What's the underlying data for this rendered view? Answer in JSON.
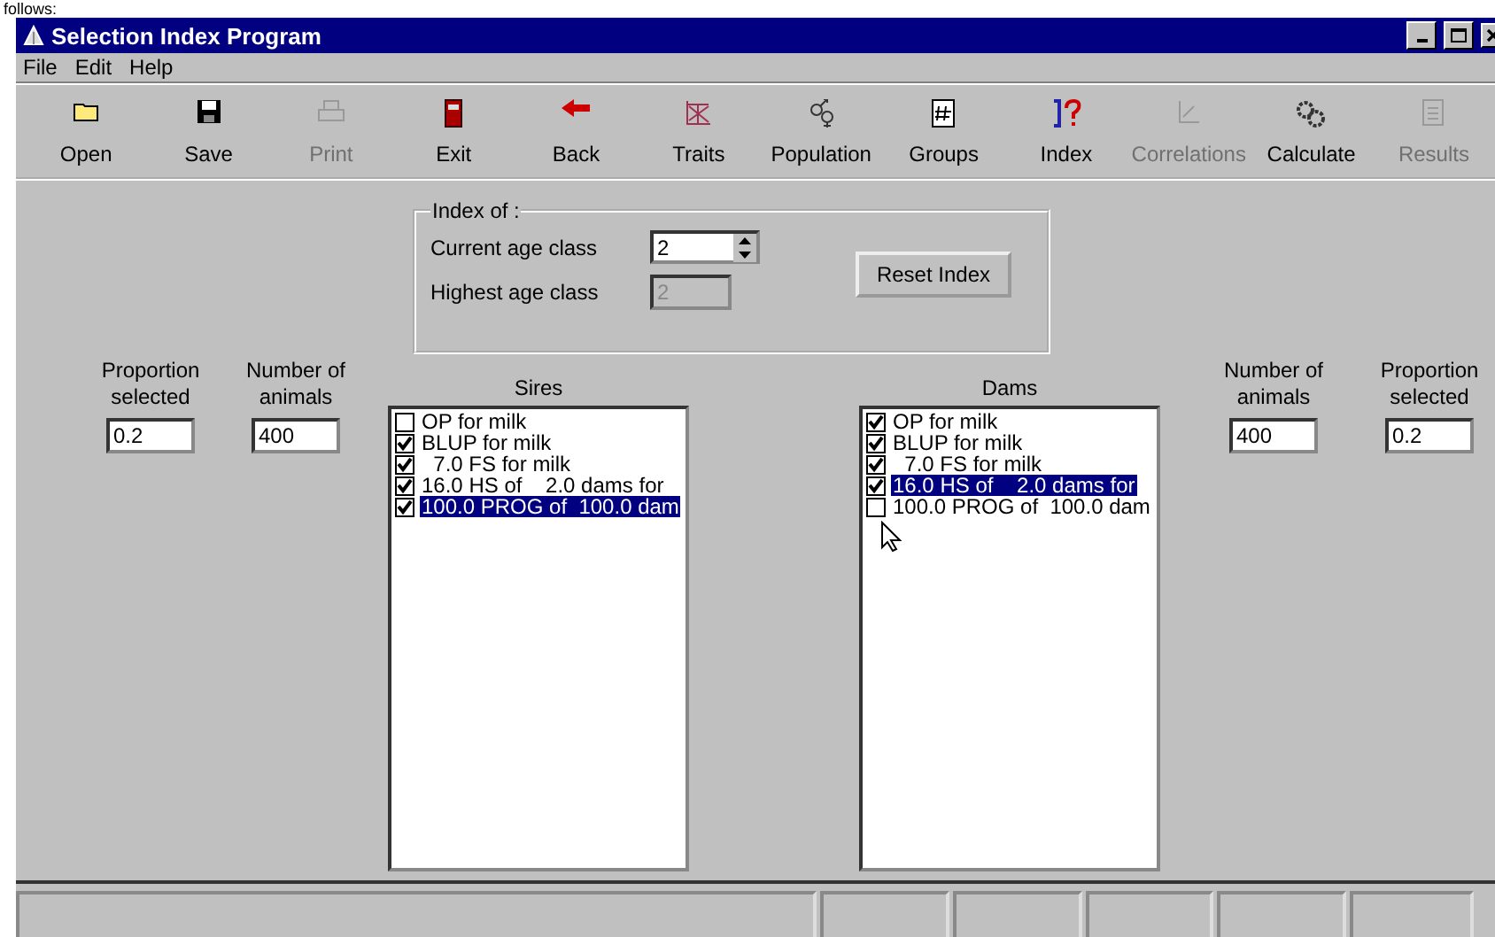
{
  "caption": "follows:",
  "window": {
    "title": "Selection Index Program"
  },
  "menu": [
    "File",
    "Edit",
    "Help"
  ],
  "toolbar": [
    {
      "label": "Open",
      "disabled": false
    },
    {
      "label": "Save",
      "disabled": false
    },
    {
      "label": "Print",
      "disabled": true
    },
    {
      "label": "Exit",
      "disabled": false
    },
    {
      "label": "Back",
      "disabled": false
    },
    {
      "label": "Traits",
      "disabled": false
    },
    {
      "label": "Population",
      "disabled": false
    },
    {
      "label": "Groups",
      "disabled": false
    },
    {
      "label": "Index",
      "disabled": false
    },
    {
      "label": "Correlations",
      "disabled": true
    },
    {
      "label": "Calculate",
      "disabled": false
    },
    {
      "label": "Results",
      "disabled": true
    }
  ],
  "index_group": {
    "title": "Index of :",
    "current_label": "Current age class",
    "current_value": "2",
    "highest_label": "Highest age class",
    "highest_value": "2",
    "highest_disabled": true
  },
  "reset_button": "Reset Index",
  "sires": {
    "proportion_label": "Proportion selected",
    "proportion_value": "0.2",
    "number_label": "Number of animals",
    "number_value": "400",
    "title": "Sires",
    "items": [
      {
        "label": "OP for milk",
        "checked": false,
        "selected": false
      },
      {
        "label": "BLUP for milk",
        "checked": true,
        "selected": false
      },
      {
        "label": "  7.0 FS for milk",
        "checked": true,
        "selected": false
      },
      {
        "label": "16.0 HS of    2.0 dams for",
        "checked": true,
        "selected": false
      },
      {
        "label": "100.0 PROG of  100.0 dam",
        "checked": true,
        "selected": true
      }
    ]
  },
  "dams": {
    "proportion_label": "Proportion selected",
    "proportion_value": "0.2",
    "number_label": "Number of animals",
    "number_value": "400",
    "title": "Dams",
    "items": [
      {
        "label": "OP for milk",
        "checked": true,
        "selected": false
      },
      {
        "label": "BLUP for milk",
        "checked": true,
        "selected": false
      },
      {
        "label": "  7.0 FS for milk",
        "checked": true,
        "selected": false
      },
      {
        "label": "16.0 HS of    2.0 dams for",
        "checked": true,
        "selected": true
      },
      {
        "label": "100.0 PROG of  100.0 dam",
        "checked": false,
        "selected": false
      }
    ]
  }
}
